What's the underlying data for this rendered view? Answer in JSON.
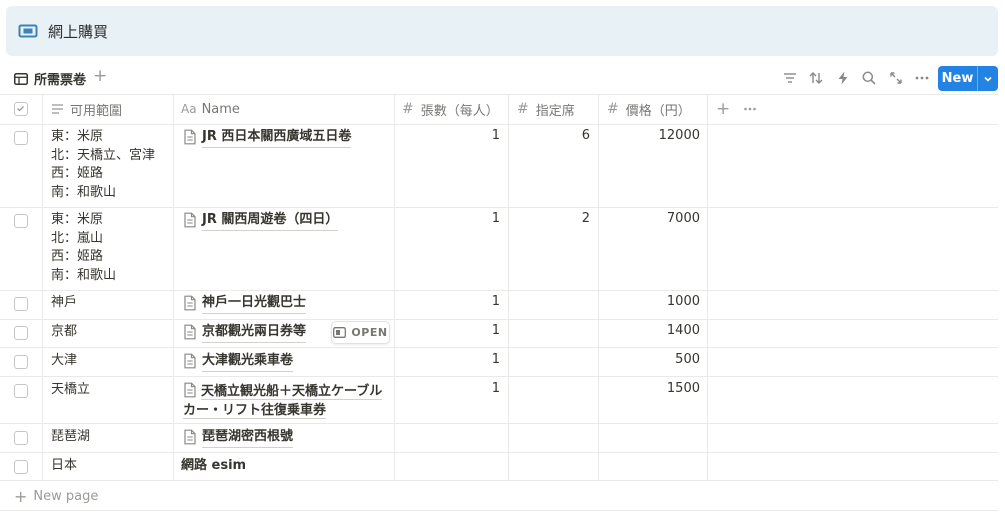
{
  "page": {
    "title": "網上購買",
    "title_icon": "ticket-icon"
  },
  "view": {
    "tab_label": "所需票卷",
    "new_label": "New"
  },
  "columns": {
    "range": "可用範圍",
    "name_prefix": "Aa",
    "name": "Name",
    "count": "張數（每人）",
    "reserved": "指定席",
    "price": "價格（円）"
  },
  "rows": [
    {
      "range": [
        "東：米原",
        "北：天橋立、宮津",
        "西：姬路",
        "南：和歌山"
      ],
      "name": "JR 西日本關西廣域五日卷",
      "has_doc": true,
      "count": "1",
      "reserved": "6",
      "price": "12000"
    },
    {
      "range": [
        "東：米原",
        "北：嵐山",
        "西：姬路",
        "南：和歌山"
      ],
      "name": "JR 關西周遊卷（四日）",
      "has_doc": true,
      "count": "1",
      "reserved": "2",
      "price": "7000"
    },
    {
      "range": [
        "神戶"
      ],
      "name": "神戶一日光觀巴士",
      "has_doc": true,
      "count": "1",
      "reserved": "",
      "price": "1000"
    },
    {
      "range": [
        "京都"
      ],
      "name": "京都觀光兩日券等",
      "has_doc": true,
      "count": "1",
      "reserved": "",
      "price": "1400",
      "open_label": "OPEN"
    },
    {
      "range": [
        "大津"
      ],
      "name": "大津觀光乘車卷",
      "has_doc": true,
      "count": "1",
      "reserved": "",
      "price": "500"
    },
    {
      "range": [
        "天橋立"
      ],
      "name": "天橋立観光船＋天橋立ケーブルカー・リフト往復乗車券",
      "has_doc": true,
      "count": "1",
      "reserved": "",
      "price": "1500"
    },
    {
      "range": [
        "琵琶湖"
      ],
      "name": "琵琶湖密西根號",
      "has_doc": true,
      "count": "",
      "reserved": "",
      "price": ""
    },
    {
      "range": [
        "日本"
      ],
      "name": "網路 esim",
      "has_doc": false,
      "count": "",
      "reserved": "",
      "price": ""
    }
  ],
  "footer": {
    "new_page": "New page"
  },
  "colors": {
    "accent": "#2383e2",
    "banner": "#e7f1f6",
    "ticket_icon": "#3d82b8"
  }
}
